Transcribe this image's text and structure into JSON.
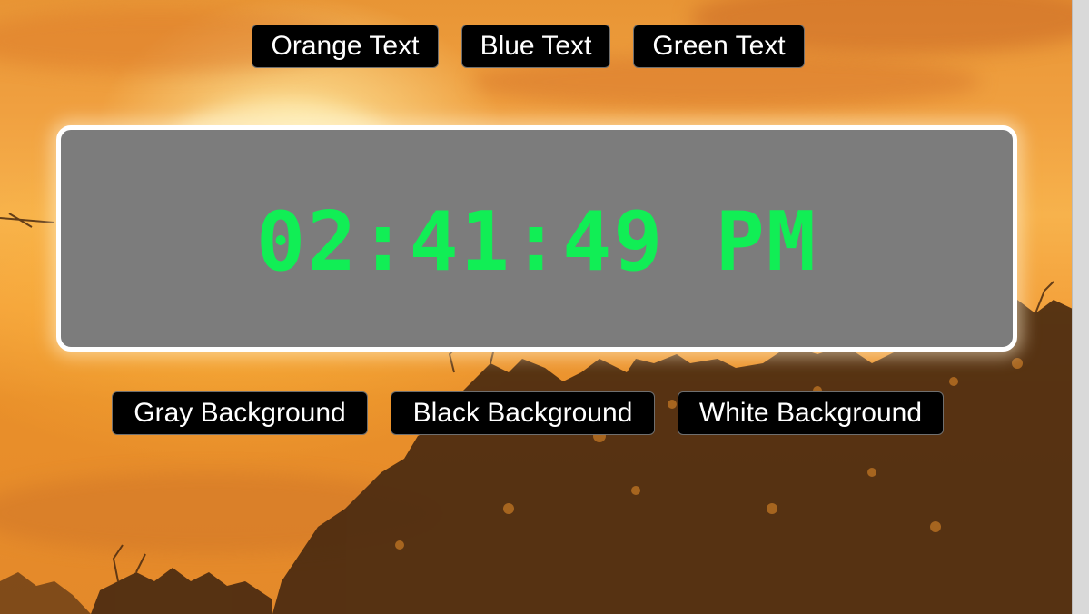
{
  "text_color_buttons": [
    {
      "label": "Orange Text"
    },
    {
      "label": "Blue Text"
    },
    {
      "label": "Green Text"
    }
  ],
  "clock": {
    "time": "02:41:49 PM",
    "text_color": "#11ee55",
    "background_color": "#7c7c7c"
  },
  "background_buttons": [
    {
      "label": "Gray Background"
    },
    {
      "label": "Black Background"
    },
    {
      "label": "White Background"
    }
  ],
  "colors": {
    "button_background": "#000000",
    "button_text": "#ffffff",
    "panel_border": "#ffffff"
  },
  "background_image": "sunset sky with tree silhouettes"
}
